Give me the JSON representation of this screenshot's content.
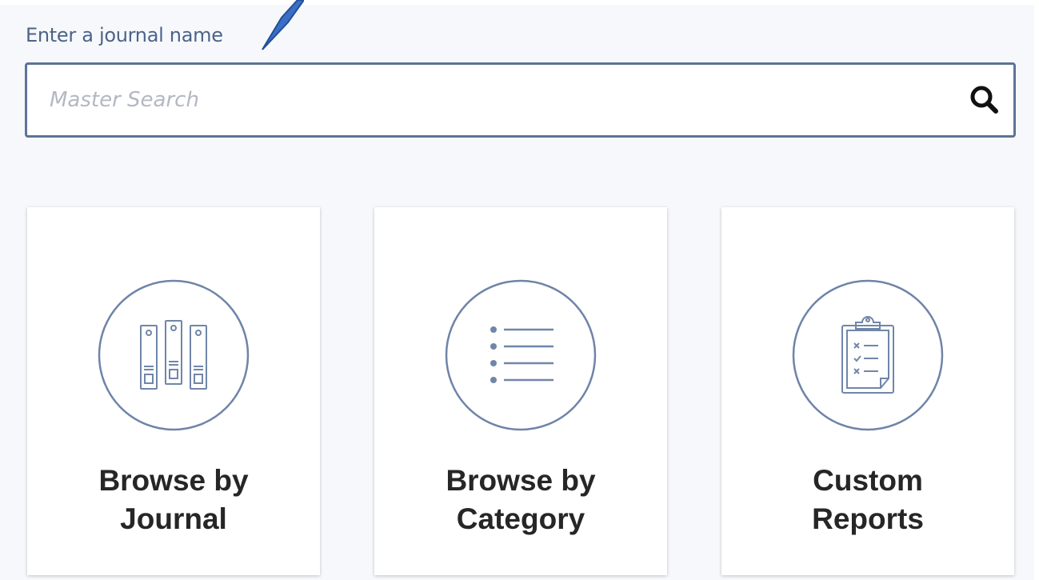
{
  "search": {
    "label": "Enter a journal name",
    "placeholder": "Master Search",
    "value": ""
  },
  "cards": [
    {
      "line1": "Browse by",
      "line2": "Journal",
      "icon": "binders-icon"
    },
    {
      "line1": "Browse by",
      "line2": "Category",
      "icon": "list-icon"
    },
    {
      "line1": "Custom",
      "line2": "Reports",
      "icon": "clipboard-icon"
    }
  ],
  "colors": {
    "accent": "#5e7396",
    "label": "#4b6489",
    "arrow": "#3b6fc4",
    "background": "#f7f8fb"
  }
}
